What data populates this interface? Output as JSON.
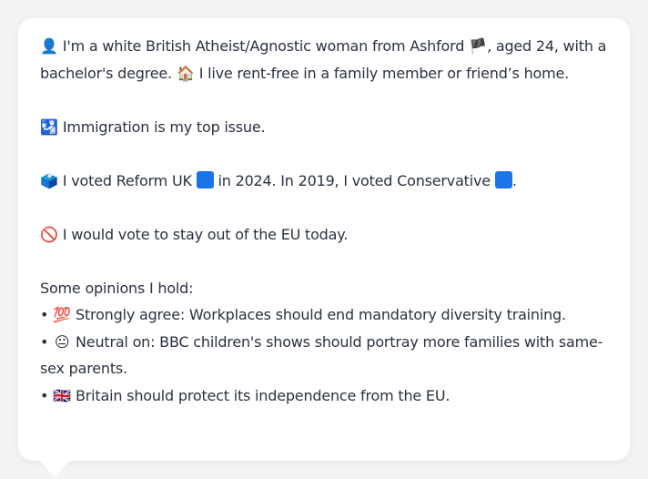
{
  "profile": {
    "intro": {
      "icon": "👤",
      "text1": " I'm a white British Atheist/Agnostic woman from Ashford ",
      "flag": "🏴",
      "text2": ", aged 24, with a bachelor's degree. ",
      "house": "🏠",
      "text3": " I live rent-free in a family member or friend’s home."
    },
    "issue": {
      "icon": "🛂",
      "text": " Immigration is my top issue."
    },
    "vote": {
      "icon": "🗳️",
      "text1": " I voted Reform UK ",
      "text2": " in 2024. In 2019, I voted Conservative ",
      "text3": ".",
      "reform_color": "#1a73e8",
      "conservative_color": "#1a73e8"
    },
    "eu": {
      "icon": "🚫",
      "text": " I would vote to stay out of the EU today."
    },
    "opinions_heading": "Some opinions I hold:",
    "opinions": [
      {
        "bullet": "•",
        "icon": "💯",
        "text": " Strongly agree: Workplaces should end mandatory diversity training."
      },
      {
        "bullet": "•",
        "icon": "😐",
        "text": " Neutral on: BBC children's shows should portray more families with same-sex parents."
      },
      {
        "bullet": "•",
        "icon": "🇬🇧",
        "text": " Britain should protect its independence from the EU."
      }
    ]
  }
}
